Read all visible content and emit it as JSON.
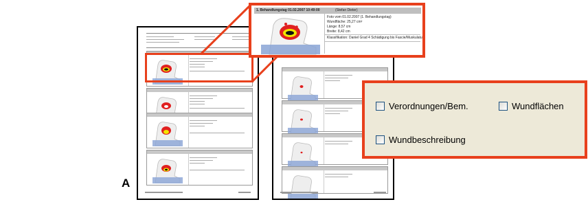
{
  "figure": {
    "panel_label": "A"
  },
  "zoom": {
    "title_left": "1. Behandlungstag 01.02.2007 10:49:00",
    "title_right": "(Stefan Dieter)",
    "info_lines": [
      "Foto vom 01.02.2007 (1. Behandlungstag)",
      "Wundfläche: 25,27 cm²",
      "Länge: 8,57 cm",
      "Breite: 8,42 cm"
    ],
    "classification": "Klassifikation: Daniel Grad 4 Schädigung bis Fascie/Muskulatur"
  },
  "options": {
    "items": [
      {
        "label": "Verordnungen/Bem.",
        "checked": false
      },
      {
        "label": "Wundflächen",
        "checked": false
      },
      {
        "label": "Wundbeschreibung",
        "checked": false
      }
    ]
  },
  "colors": {
    "highlight": "#e8401c",
    "dialog_bg": "#ede9d8",
    "checkbox_border": "#1c5180"
  }
}
